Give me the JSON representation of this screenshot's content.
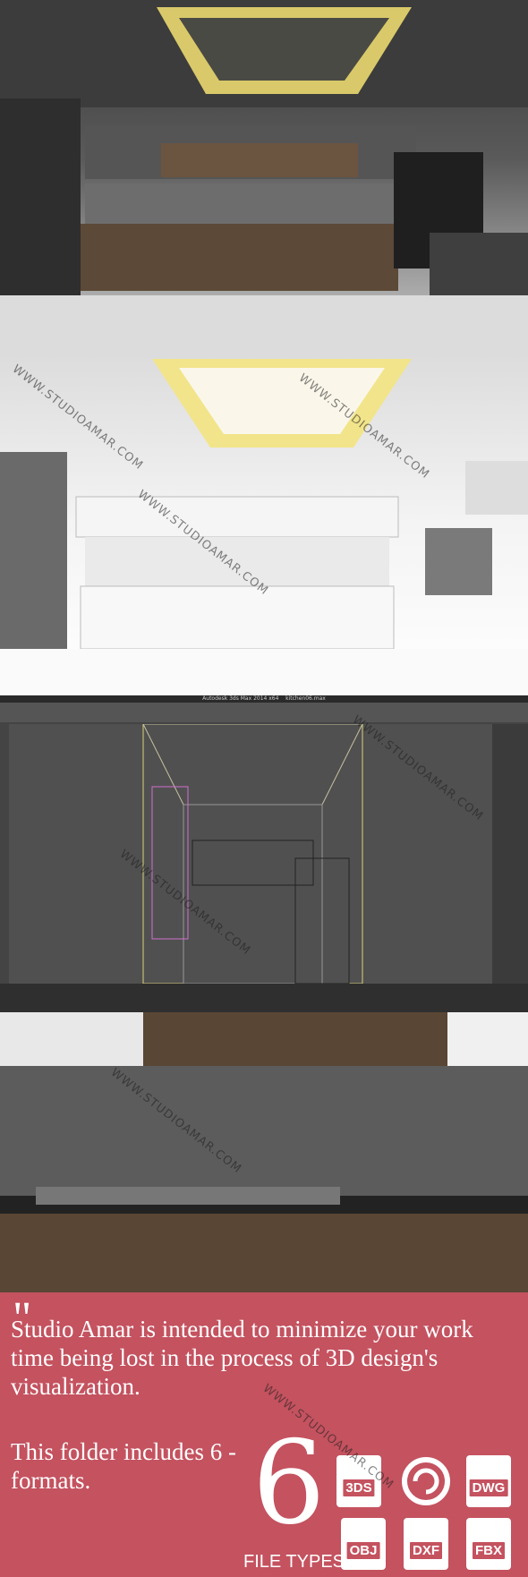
{
  "watermark": "WWW.STUDIOAMAR.COM",
  "max_window": {
    "title": "Autodesk 3ds Max 2014 x64",
    "file": "kitchen06.max"
  },
  "promo": {
    "quote_mark": "\"",
    "tagline": "Studio Amar is intended to minimize your work time being lost in the process of 3D design's visualization.",
    "includes": "This folder includes 6 - formats.",
    "big_number": "6",
    "file_types_label": "FILE TYPES",
    "formats": [
      "3DS",
      "",
      "DWG",
      "OBJ",
      "DXF",
      "FBX"
    ]
  },
  "colors": {
    "promo_bg": "#c4525f",
    "cove_light": "#f2e48a"
  }
}
